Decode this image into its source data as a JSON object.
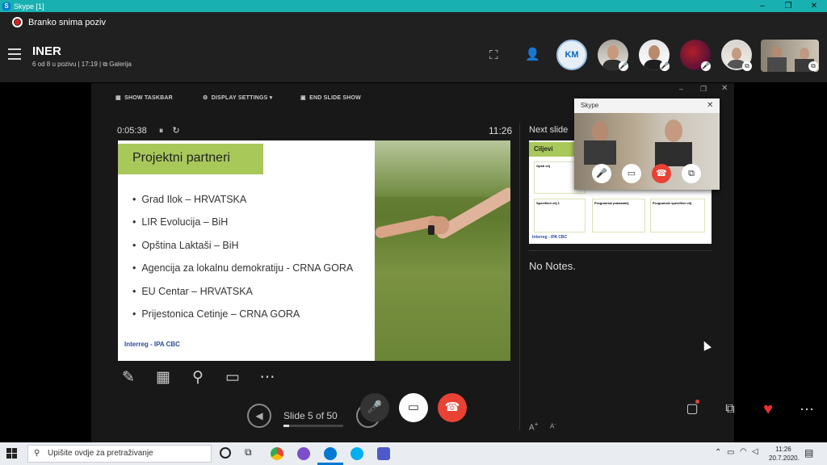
{
  "window": {
    "title": "Skype [1]",
    "controls": [
      "–",
      "❐",
      "✕"
    ]
  },
  "recording": {
    "text": "Branko snima poziv"
  },
  "call": {
    "title": "INER",
    "subtitle": "6 od 8 u pozivu | 17:19 | ⧉ Galerija",
    "avatar_initials": "KM"
  },
  "presenter": {
    "toolbar": {
      "show_taskbar": "SHOW TASKBAR",
      "display_settings": "DISPLAY SETTINGS ▾",
      "end_slide_show": "END SLIDE SHOW"
    },
    "elapsed": "0:05:38",
    "clock": "11:26",
    "next_slide_label": "Next slide",
    "notes": "No Notes.",
    "slide_counter": "Slide 5 of 50",
    "slide_progress": 0.1
  },
  "slide": {
    "title": "Projektni partneri",
    "bullets": [
      "Grad Ilok – HRVATSKA",
      "LIR Evolucija – BiH",
      "Opština Laktaši – BiH",
      "Agencija za lokalnu demokratiju  - CRNA GORA",
      "EU Centar – HRVATSKA",
      "Prijestonica Cetinje – CRNA GORA"
    ],
    "footer": "Interreg - IPA CBC"
  },
  "next_thumb": {
    "title": "Ciljevi",
    "cells": [
      "Opšti cilj",
      "Specifični cilj 1",
      "Programski pokazatelj",
      "Programski specifični cilj"
    ],
    "footer": "Interreg - IPA CBC"
  },
  "mini_window": {
    "title": "Skype"
  },
  "taskbar": {
    "search_placeholder": "Upišite ovdje za pretraživanje",
    "time": "11:26",
    "date": "20.7.2020."
  },
  "colors": {
    "titlebar": "#18b0b0",
    "end_call": "#e94235",
    "slide_accent": "#a8c85a",
    "heart": "#e8302f"
  }
}
